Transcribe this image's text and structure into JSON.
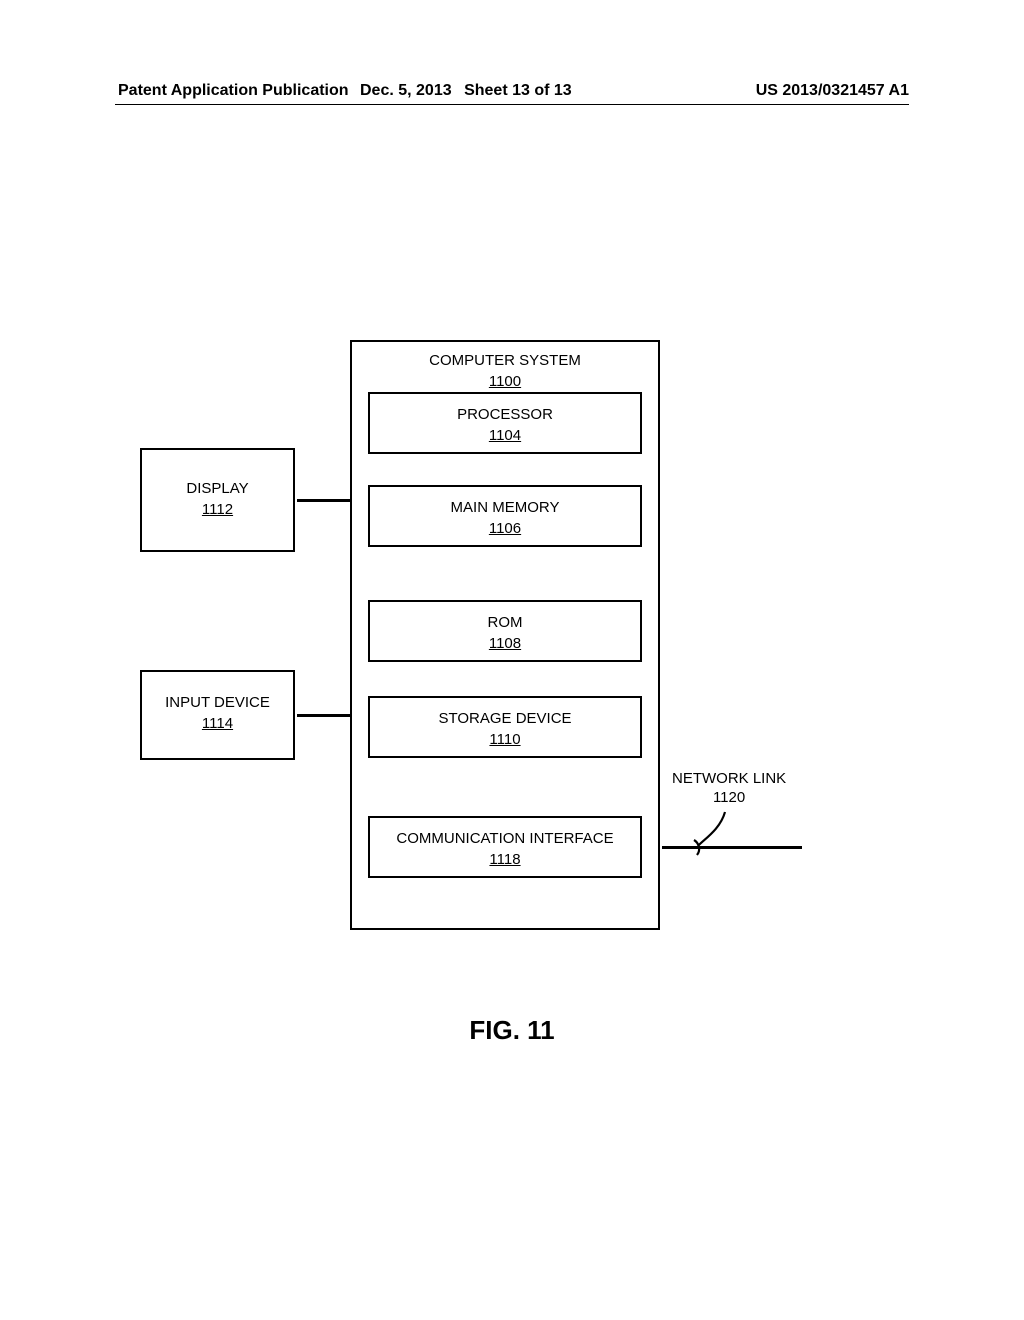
{
  "header": {
    "left": "Patent Application Publication",
    "date": "Dec. 5, 2013",
    "sheet": "Sheet 13 of 13",
    "pubno": "US 2013/0321457 A1"
  },
  "figure_caption": "FIG. 11",
  "blocks": {
    "computer_system": {
      "label": "COMPUTER SYSTEM",
      "ref": "1100"
    },
    "processor": {
      "label": "PROCESSOR",
      "ref": "1104"
    },
    "main_memory": {
      "label": "MAIN MEMORY",
      "ref": "1106"
    },
    "rom": {
      "label": "ROM",
      "ref": "1108"
    },
    "storage": {
      "label": "STORAGE DEVICE",
      "ref": "1110"
    },
    "comm": {
      "label": "COMMUNICATION INTERFACE",
      "ref": "1118"
    },
    "display": {
      "label": "DISPLAY",
      "ref": "1112"
    },
    "input": {
      "label": "INPUT DEVICE",
      "ref": "1114"
    },
    "netlink": {
      "label": "NETWORK LINK",
      "ref": "1120"
    }
  }
}
